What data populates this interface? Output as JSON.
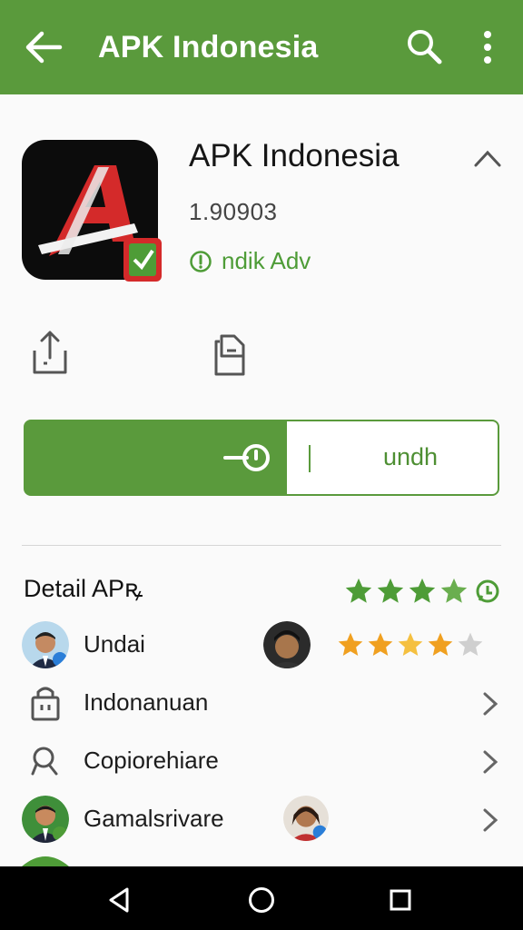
{
  "appbar": {
    "title": "APK Indonesia",
    "back_icon": "arrow-left-icon",
    "search_icon": "search-icon",
    "more_icon": "more-vertical-icon"
  },
  "app": {
    "name": "APK Indonesia",
    "version": "1.90903",
    "developer": "ndik Adv",
    "icon": "apk-logo-icon",
    "brand_color": "#d42a2a"
  },
  "actions": {
    "update_label": "undh"
  },
  "details": {
    "title": "Detail APꝶ",
    "rating_stars": 4,
    "items": [
      {
        "label": "Undai",
        "rating_stars": 4
      },
      {
        "label": "Indonanuan"
      },
      {
        "label": "Copiorehiare"
      },
      {
        "label": "Gamalsrivare"
      }
    ]
  },
  "colors": {
    "accent": "#5a9a3c",
    "star_green": "#4e9c37",
    "star_orange": "#f0a020"
  }
}
